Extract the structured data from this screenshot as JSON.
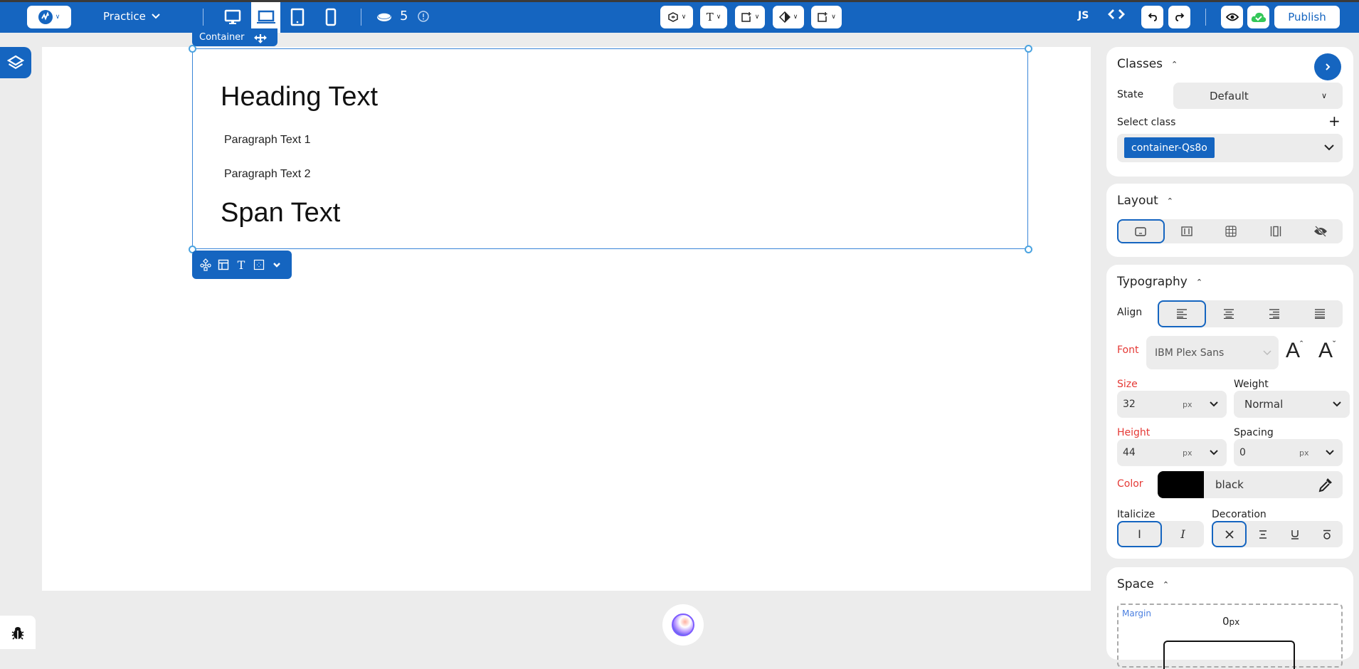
{
  "topbar": {
    "project_name": "Practice",
    "devices": [
      {
        "name": "desktop",
        "active": false
      },
      {
        "name": "laptop",
        "active": true
      },
      {
        "name": "tablet",
        "active": false
      },
      {
        "name": "mobile",
        "active": false
      }
    ],
    "credits": "5",
    "tools": [
      "components",
      "text",
      "add-element",
      "contrast",
      "add-section"
    ],
    "js_label": "JS",
    "code_label": "<>",
    "publish_label": "Publish",
    "accent": "#1565c0"
  },
  "canvas": {
    "selected_label": "Container",
    "heading": "Heading Text",
    "paragraph1": "Paragraph Text 1",
    "paragraph2": "Paragraph Text 2",
    "span": "Span Text"
  },
  "panel": {
    "classes": {
      "title": "Classes",
      "state_label": "State",
      "state_value": "Default",
      "select_class_label": "Select class",
      "class_chip": "container-Qs8o"
    },
    "layout": {
      "title": "Layout",
      "options": [
        "block",
        "flex",
        "grid",
        "inline",
        "hidden"
      ],
      "active": "block"
    },
    "typography": {
      "title": "Typography",
      "align_label": "Align",
      "align_options": [
        "left",
        "center",
        "right",
        "justify"
      ],
      "align_active": "left",
      "font_label": "Font",
      "font_value": "IBM Plex Sans",
      "size_label": "Size",
      "size_value": "32",
      "size_unit": "px",
      "weight_label": "Weight",
      "weight_value": "Normal",
      "height_label": "Height",
      "height_value": "44",
      "height_unit": "px",
      "spacing_label": "Spacing",
      "spacing_value": "0",
      "spacing_unit": "px",
      "color_label": "Color",
      "color_value": "black",
      "color_swatch": "#000000",
      "italicize_label": "Italicize",
      "italic_options": [
        "normal",
        "italic"
      ],
      "italic_active": "normal",
      "decoration_label": "Decoration",
      "decoration_options": [
        "none",
        "line-through",
        "underline",
        "overline"
      ],
      "decoration_active": "none"
    },
    "space": {
      "title": "Space",
      "margin_label": "Margin",
      "margin_top_value": "0",
      "margin_unit": "px"
    }
  }
}
